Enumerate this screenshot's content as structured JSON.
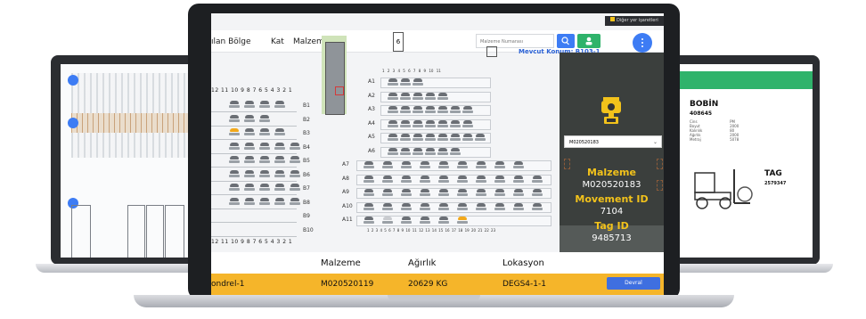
{
  "header": {
    "zone_tab": "ılan Bölge",
    "floor_tab": "Kat",
    "material_tab": "Malzeme",
    "search_placeholder": "Malzeme Numarası",
    "current_location": "Mevcut Konum: B103-1",
    "notification": "Diğer yer işaretleri"
  },
  "rack_numbers_top": "12 11 10 9 8 7 6 5 4 3 2 1",
  "rack_numbers_bottom": "12 11 10 9 8 7 6 5 4 3 2 1",
  "b_rows": [
    "B1",
    "B2",
    "B3",
    "B4",
    "B5",
    "B6",
    "B7",
    "B8",
    "B9",
    "B10"
  ],
  "a_rows": [
    "A1",
    "A2",
    "A3",
    "A4",
    "A5",
    "A6",
    "A7",
    "A8",
    "A9",
    "A10",
    "A11"
  ],
  "a_numbers_top": "1 2 3 4 5 6 7 8 9 10 11",
  "a_numbers_bottom": "1 2 3 4 5 6 7 8 9 10 11 12 13 14 15 16 17 18 19 20 21 22 23",
  "side_panel": {
    "dropdown_value": "M020520183",
    "material_label": "Malzeme",
    "material_value": "M020520183",
    "movement_label": "Movement ID",
    "movement_value": "7104",
    "tag_label": "Tag ID",
    "tag_value": "9485713"
  },
  "table": {
    "headers": [
      "Malzeme",
      "Ağırlık",
      "Lokasyon"
    ],
    "row": {
      "name": "ondrel-1",
      "material": "M020520119",
      "weight": "20629 KG",
      "location": "DEGS4-1-1",
      "action": "Devral"
    }
  },
  "right_screen": {
    "title": "BOBİN",
    "code": "408645",
    "tag_label": "TAG",
    "tag_value": "2579347",
    "rows": [
      [
        "Cins",
        "PM"
      ],
      [
        "Boyut",
        "2000"
      ],
      [
        "Kalınlık",
        "80"
      ],
      [
        "Ağırlık",
        "2000"
      ],
      [
        "Metraj",
        "5078"
      ]
    ]
  },
  "colors": {
    "accent_blue": "#3d7cf4",
    "accent_green": "#2fb36b",
    "panel_dark": "#3b3f3d",
    "gold": "#f2c21b",
    "table_bar": "#f5b52a",
    "action_button": "#3f6fe0"
  }
}
